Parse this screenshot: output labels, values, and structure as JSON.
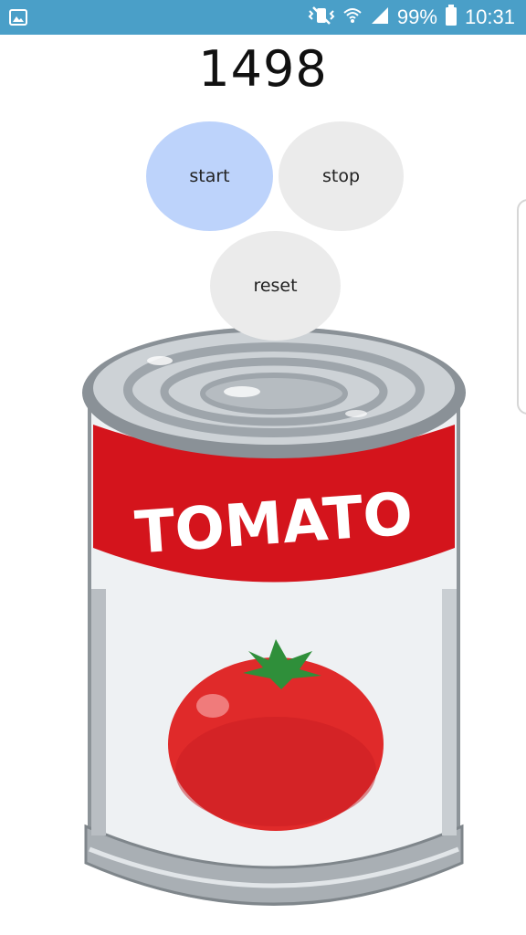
{
  "status_bar": {
    "battery_percent": "99%",
    "time": "10:31",
    "icons": [
      "gallery-icon",
      "mute-vibrate-icon",
      "wifi-icon",
      "signal-icon",
      "battery-icon"
    ]
  },
  "counter": {
    "value": "1498"
  },
  "buttons": {
    "start": "start",
    "stop": "stop",
    "reset": "reset"
  },
  "illustration": {
    "label_text": "TOMATO",
    "colors": {
      "label_red": "#d4141c",
      "can_silver": "#b9bec3",
      "tomato_red": "#e02a2a",
      "leaf_green": "#2f8f3a"
    }
  },
  "colors": {
    "status_bar": "#4a9fc8",
    "start_button": "#bdd3fb",
    "secondary_button": "#ebebeb"
  }
}
